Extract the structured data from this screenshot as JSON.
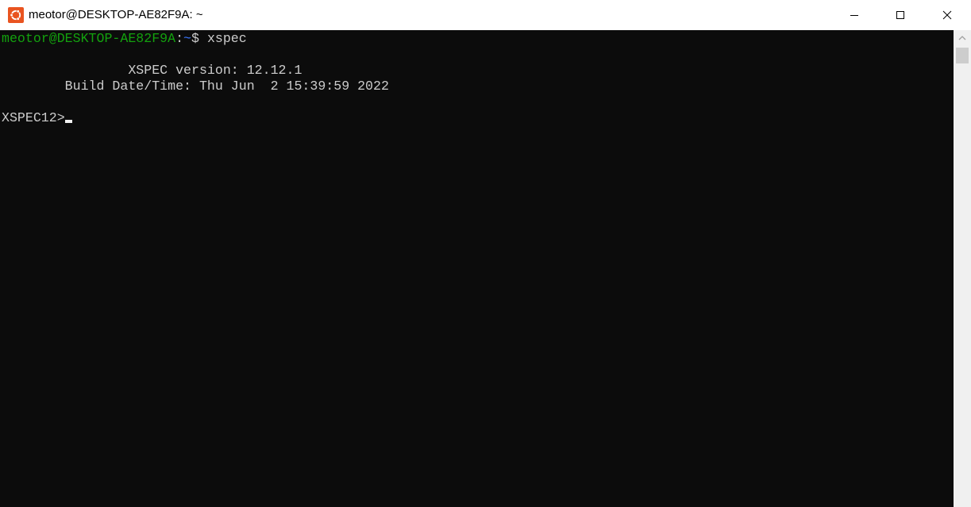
{
  "window": {
    "title": "meotor@DESKTOP-AE82F9A: ~",
    "app_icon": "ubuntu-icon",
    "controls": {
      "minimize_icon": "minimize-icon",
      "maximize_icon": "maximize-icon",
      "close_icon": "close-icon"
    }
  },
  "terminal": {
    "prompt": {
      "user_host": "meotor@DESKTOP-AE82F9A",
      "separator": ":",
      "path": "~",
      "symbol": "$ ",
      "command": "xspec"
    },
    "output": [
      "                XSPEC version: 12.12.1",
      "        Build Date/Time: Thu Jun  2 15:39:59 2022"
    ],
    "xspec_prompt": "XSPEC12>"
  },
  "colors": {
    "background": "#0c0c0c",
    "user_host": "#13a10e",
    "path": "#3b78ff",
    "text": "#cccccc"
  }
}
